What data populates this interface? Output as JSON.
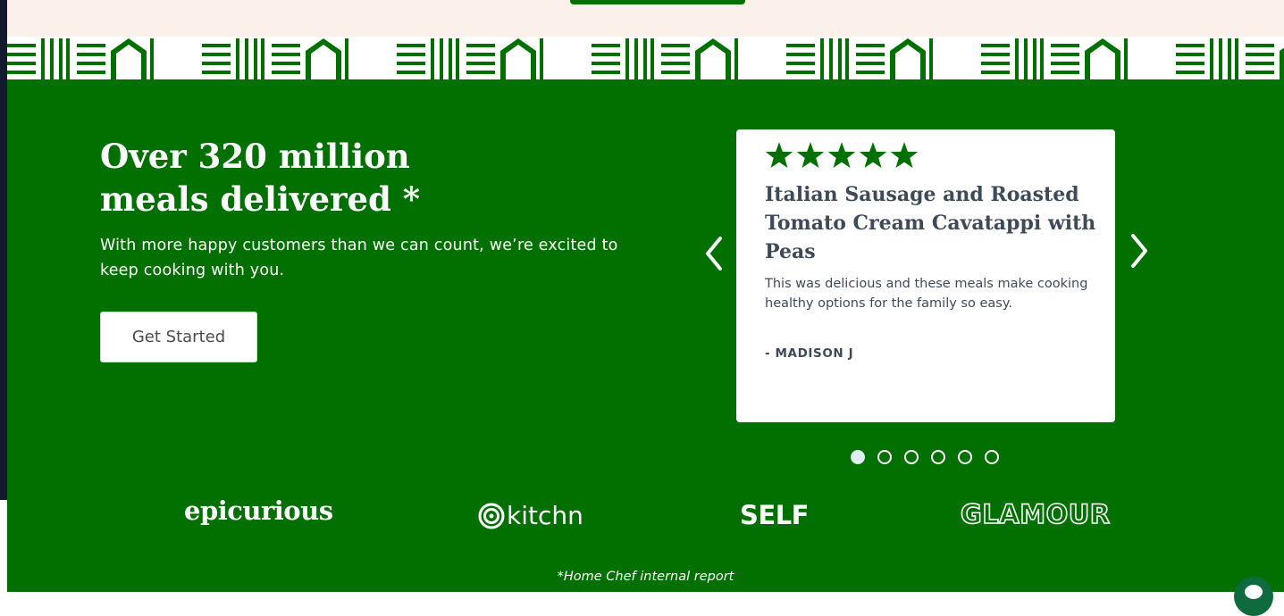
{
  "page": {
    "headline_line1": "Over 320 million",
    "headline_line2": "meals delivered *",
    "subtext": "With more happy customers than we can count, we’re excited to keep cooking with you.",
    "cta_label": "Get Started",
    "footnote": "*Home Chef internal report"
  },
  "review": {
    "rating": 5,
    "rating_max": 5,
    "title": "Italian Sausage and Roasted Tomato Cream Cavatappi with Peas",
    "quote": "This was delicious and these meals make cooking healthy options for the family so easy.",
    "author": "- MADISON J"
  },
  "carousel": {
    "slide_count": 6,
    "active_slide": 1,
    "prev_icon": "chevron-left-icon",
    "next_icon": "chevron-right-icon"
  },
  "press_logos": {
    "epicurious": "epicurious",
    "kitchn": "kitchn",
    "self": "SELF",
    "glamour": "GLAMOUR"
  },
  "colors": {
    "brand_green": "#017000",
    "cream": "#fbf0ea",
    "text_dark": "#3f4a59",
    "dark_strip": "#141a2e",
    "chat_green": "#0f6b3e"
  },
  "icons": {
    "star": "star-icon",
    "chat": "chat-icon",
    "pattern": "house-and-stripes-pattern"
  }
}
